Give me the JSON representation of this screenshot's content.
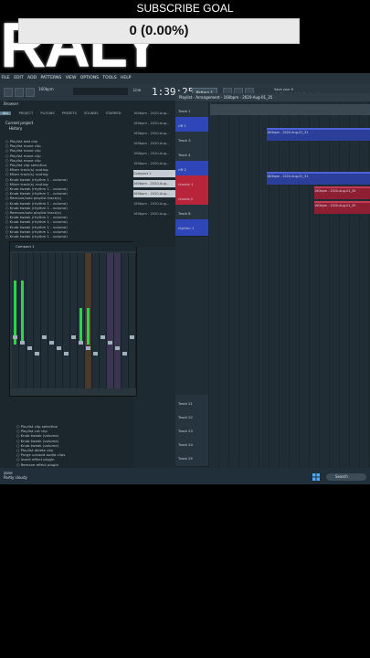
{
  "overlay": {
    "subscribe_label": "SUBSCRIBE GOAL",
    "goal_value": "0 (0.00%)",
    "ghost_text": "RALY"
  },
  "menubar": {
    "items": [
      "FILE",
      "EDIT",
      "ADD",
      "PATTERNS",
      "VIEW",
      "OPTIONS",
      "TOOLS",
      "HELP"
    ],
    "project_info": "160bpm",
    "time": "1:39:25",
    "pattern_label": "Pattern 1",
    "line_mode": "Line",
    "hint_line1": "Save your fl",
    "hint_line2": "studio projects to the cloud"
  },
  "browser": {
    "title": "Browser",
    "tabs": [
      "ALL",
      "PROJECT",
      "PLUGINS",
      "PRESETS",
      "SOUNDS",
      "STARRED"
    ],
    "section_current": "Current project",
    "section_history": "History",
    "history": [
      "Playlist add clip",
      "Playlist move clip",
      "Playlist move clip",
      "Playlist move clip",
      "Playlist move clip",
      "Playlist clip selection",
      "Mixer track(s) routing",
      "Mixer track(s) routing",
      "Knob tweak (rhythm 1 - volume)",
      "Mixer track(s) routing",
      "Knob tweak (rhythm 1 - volume)",
      "Knob tweak (rhythm 1 - volume)",
      "Remove/solo playlist track(s)",
      "Knob tweak (rhythm 1 - volume)",
      "Knob tweak (rhythm 1 - volume)",
      "Remove/solo playlist track(s)",
      "Knob tweak (rhythm 1 - volume)",
      "Knob tweak (rhythm 1 - volume)",
      "Knob tweak (rhythm 1 - volume)",
      "Knob tweak (rhythm 1 - volume)",
      "Knob tweak (rhythm 1 - volume)"
    ],
    "history_lower": [
      "Playlist clip selection",
      "Playlist cut clip",
      "Knob tweak (volume)",
      "Knob tweak (volume)",
      "Knob tweak (volume)",
      "Playlist delete clip",
      "Purge unused audio clips",
      "Insert effect plugin",
      "Remove effect plugin",
      "Insert effect plugin",
      "Knob tweak (guitar - volume)",
      "Remove/solo playlist track(s)"
    ]
  },
  "mixer": {
    "title": "Compact 1"
  },
  "channel_rack": {
    "items": [
      "160bpm - 2020-Aug...",
      "160bpm - 2020-Aug...",
      "160bpm - 2020-Aug...",
      "160bpm - 2020-Aug...",
      "160bpm - 2020-Aug...",
      "160bpm - 2020-Aug...",
      "Compact 1",
      "160bpm - 2020-Aug...",
      "160bpm - 2020-Aug...",
      "160bpm - 2020-Aug...",
      "160bpm - 2020-Aug..."
    ]
  },
  "playlist": {
    "title": "Playlist - Arrangement - 160bpm - 2020-Aug-01_35",
    "tracks": [
      "Track 1",
      "riff 1",
      "Track 3",
      "Track 4",
      "riff 2",
      "chords 1",
      "chords 2",
      "Track 8",
      "rhythm 1"
    ],
    "tracks_lower": [
      "Track 21",
      "Track 22",
      "Track 23",
      "Track 24",
      "Track 25"
    ],
    "clips": {
      "riff1": "160bpm - 2020-Aug-01_31",
      "riff2": "160bpm - 2020-Aug-01_31",
      "chord1": "160bpm - 2020-Aug-01_35",
      "chord2": "160bpm - 2020-Aug-01_35"
    }
  },
  "taskbar": {
    "user_line1": "zone",
    "user_line2": "Partly cloudy",
    "search_label": "Search"
  }
}
